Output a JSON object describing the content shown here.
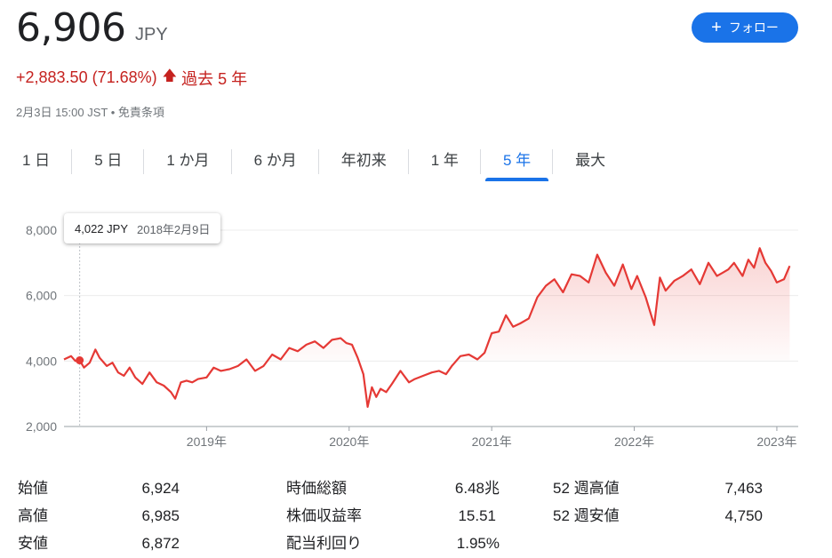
{
  "header": {
    "price": "6,906",
    "currency": "JPY",
    "follow_label": "フォロー",
    "change": "+2,883.50 (71.68%)",
    "period": "過去 5 年",
    "timestamp": "2月3日 15:00 JST",
    "separator": "•",
    "disclaimer": "免責条項"
  },
  "tabs": [
    {
      "label": "1 日",
      "active": false
    },
    {
      "label": "5 日",
      "active": false
    },
    {
      "label": "1 か月",
      "active": false
    },
    {
      "label": "6 か月",
      "active": false
    },
    {
      "label": "年初来",
      "active": false
    },
    {
      "label": "1 年",
      "active": false
    },
    {
      "label": "5 年",
      "active": true
    },
    {
      "label": "最大",
      "active": false
    }
  ],
  "tooltip": {
    "value": "4,022 JPY",
    "date": "2018年2月9日"
  },
  "colors": {
    "accent": "#1a73e8",
    "line": "#e53935",
    "negative": "#c5221f",
    "text": "#202124",
    "muted": "#70757a"
  },
  "chart_data": {
    "type": "line",
    "y_tick_labels": [
      "8,000",
      "6,000",
      "4,000",
      "2,000"
    ],
    "y_ticks": [
      8000,
      6000,
      4000,
      2000
    ],
    "x_tick_labels": [
      "2019年",
      "2020年",
      "2021年",
      "2022年",
      "2023年"
    ],
    "x_ticks": [
      2019.0,
      2020.0,
      2021.0,
      2022.0,
      2023.0
    ],
    "ylim": [
      2000,
      8000
    ],
    "xlim": [
      2018.0,
      2023.15
    ],
    "baseline": 4022,
    "start_point": [
      2018.11,
      4022
    ],
    "series": [
      {
        "x": [
          2018.0,
          2018.05,
          2018.08,
          2018.11,
          2018.14,
          2018.18,
          2018.22,
          2018.25,
          2018.3,
          2018.34,
          2018.38,
          2018.42,
          2018.46,
          2018.5,
          2018.55,
          2018.6,
          2018.65,
          2018.7,
          2018.75,
          2018.78,
          2018.82,
          2018.86,
          2018.9,
          2018.94,
          2019.0,
          2019.05,
          2019.1,
          2019.16,
          2019.22,
          2019.28,
          2019.34,
          2019.4,
          2019.46,
          2019.52,
          2019.58,
          2019.64,
          2019.7,
          2019.76,
          2019.82,
          2019.88,
          2019.94,
          2019.98,
          2020.02,
          2020.06,
          2020.1,
          2020.13,
          2020.16,
          2020.19,
          2020.22,
          2020.26,
          2020.3,
          2020.36,
          2020.42,
          2020.46,
          2020.52,
          2020.58,
          2020.63,
          2020.68,
          2020.72,
          2020.78,
          2020.84,
          2020.9,
          2020.95,
          2021.0,
          2021.05,
          2021.1,
          2021.15,
          2021.2,
          2021.26,
          2021.32,
          2021.38,
          2021.44,
          2021.5,
          2021.56,
          2021.62,
          2021.68,
          2021.74,
          2021.8,
          2021.86,
          2021.92,
          2021.98,
          2022.02,
          2022.08,
          2022.14,
          2022.18,
          2022.22,
          2022.28,
          2022.34,
          2022.4,
          2022.46,
          2022.52,
          2022.58,
          2022.62,
          2022.66,
          2022.7,
          2022.76,
          2022.8,
          2022.84,
          2022.88,
          2022.92,
          2022.96,
          2023.0,
          2023.05,
          2023.09
        ],
        "y": [
          4050,
          4150,
          4000,
          4022,
          3800,
          3950,
          4350,
          4100,
          3850,
          3950,
          3650,
          3550,
          3800,
          3500,
          3300,
          3650,
          3350,
          3250,
          3050,
          2850,
          3350,
          3400,
          3350,
          3450,
          3500,
          3800,
          3700,
          3750,
          3850,
          4050,
          3700,
          3850,
          4200,
          4050,
          4400,
          4300,
          4500,
          4600,
          4400,
          4650,
          4700,
          4550,
          4500,
          4100,
          3600,
          2600,
          3200,
          2900,
          3150,
          3050,
          3300,
          3700,
          3350,
          3450,
          3550,
          3650,
          3700,
          3600,
          3850,
          4150,
          4200,
          4050,
          4250,
          4850,
          4900,
          5400,
          5050,
          5150,
          5300,
          5950,
          6300,
          6500,
          6100,
          6650,
          6600,
          6400,
          7250,
          6700,
          6300,
          6950,
          6200,
          6600,
          5950,
          5100,
          6550,
          6150,
          6450,
          6600,
          6800,
          6350,
          7000,
          6600,
          6700,
          6800,
          7000,
          6600,
          7100,
          6850,
          7450,
          7000,
          6750,
          6400,
          6500,
          6906
        ]
      }
    ]
  },
  "stats": {
    "col1": [
      {
        "label": "始値",
        "value": "6,924"
      },
      {
        "label": "高値",
        "value": "6,985"
      },
      {
        "label": "安値",
        "value": "6,872"
      }
    ],
    "col2": [
      {
        "label": "時価総額",
        "value": "6.48兆"
      },
      {
        "label": "株価収益率",
        "value": "15.51"
      },
      {
        "label": "配当利回り",
        "value": "1.95%"
      }
    ],
    "col3": [
      {
        "label": "52 週高値",
        "value": "7,463"
      },
      {
        "label": "52 週安値",
        "value": "4,750"
      }
    ]
  }
}
